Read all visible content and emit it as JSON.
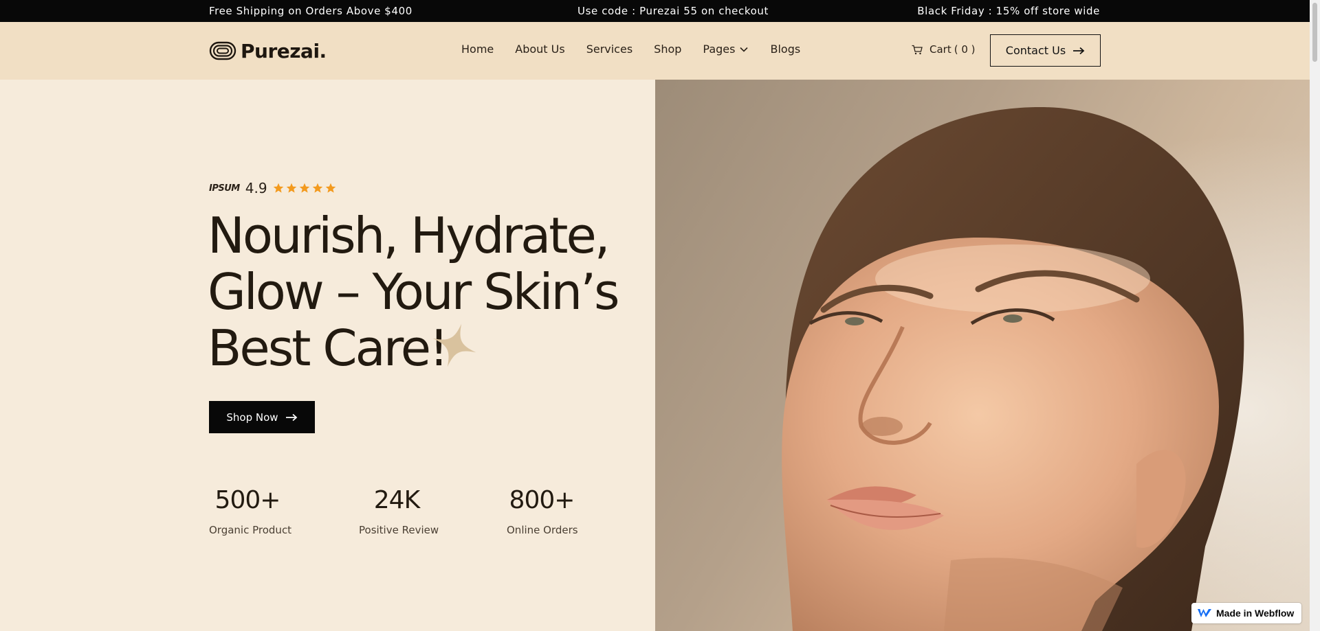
{
  "announcement": {
    "left": "Free Shipping on Orders Above $400",
    "center": "Use code : Purezai 55 on checkout",
    "right": "Black Friday : 15% off store wide"
  },
  "brand": {
    "name": "Purezai."
  },
  "nav": {
    "items": [
      {
        "label": "Home"
      },
      {
        "label": "About Us"
      },
      {
        "label": "Services"
      },
      {
        "label": "Shop"
      },
      {
        "label": "Pages",
        "icon": "chevron-down-icon"
      },
      {
        "label": "Blogs"
      }
    ],
    "cart_label": "Cart",
    "cart_count": "( 0 )",
    "contact_label": "Contact Us"
  },
  "hero": {
    "rating_brand": "IPSUM",
    "rating_score": "4.9",
    "rating_stars": 5,
    "headline_lines": [
      "Nourish, Hydrate,",
      "Glow – Your Skin’s",
      "Best Care!"
    ],
    "cta_label": "Shop Now",
    "stats": [
      {
        "value": "500+",
        "label": "Organic Product"
      },
      {
        "value": "24K",
        "label": "Positive Review"
      },
      {
        "value": "800+",
        "label": "Online Orders"
      }
    ]
  },
  "badge": {
    "label": "Made in Webflow"
  },
  "colors": {
    "accent_star": "#f39a1e",
    "sparkle": "#d9c29e",
    "dark": "#080808",
    "header_bg": "#f1dfc4",
    "page_bg": "#f6ebdb"
  }
}
